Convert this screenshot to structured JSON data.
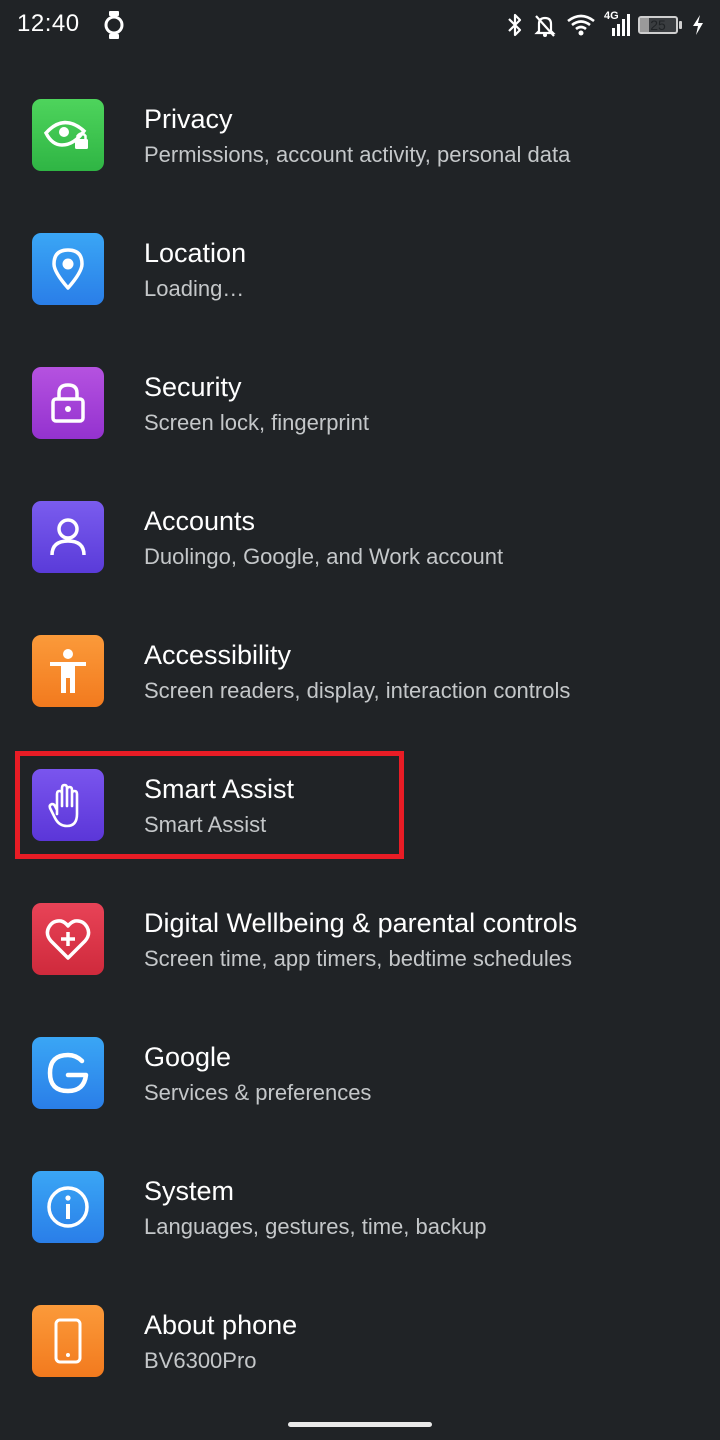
{
  "status_bar": {
    "time": "12:40",
    "battery_level": "25",
    "network": "4G",
    "icons": [
      "watch-icon",
      "bluetooth-icon",
      "notifications-off-icon",
      "wifi-icon",
      "cellular-signal-icon",
      "battery-icon",
      "charging-icon"
    ]
  },
  "settings": {
    "items": [
      {
        "title": "Privacy",
        "subtitle": "Permissions, account activity, personal data",
        "icon": "privacy-eye-lock-icon",
        "color": "#3ec64f"
      },
      {
        "title": "Location",
        "subtitle": "Loading…",
        "icon": "location-pin-icon",
        "color": "#2d8ff0"
      },
      {
        "title": "Security",
        "subtitle": "Screen lock, fingerprint",
        "icon": "padlock-icon",
        "color": "#a741d9"
      },
      {
        "title": "Accounts",
        "subtitle": "Duolingo, Google, and Work account",
        "icon": "person-icon",
        "color": "#6b4de6"
      },
      {
        "title": "Accessibility",
        "subtitle": "Screen readers, display, interaction controls",
        "icon": "accessibility-person-icon",
        "color": "#f78a2c"
      },
      {
        "title": "Smart Assist",
        "subtitle": "Smart Assist",
        "icon": "hand-icon",
        "color": "#6944e0"
      },
      {
        "title": "Digital Wellbeing & parental controls",
        "subtitle": "Screen time, app timers, bedtime schedules",
        "icon": "heart-plus-icon",
        "color": "#e0344a"
      },
      {
        "title": "Google",
        "subtitle": "Services & preferences",
        "icon": "google-g-icon",
        "color": "#2b8ef0"
      },
      {
        "title": "System",
        "subtitle": "Languages, gestures, time, backup",
        "icon": "info-icon",
        "color": "#2b8ef0"
      },
      {
        "title": "About phone",
        "subtitle": "BV6300Pro",
        "icon": "phone-icon",
        "color": "#f78a2c"
      }
    ]
  },
  "highlight_color": "#e81c25"
}
